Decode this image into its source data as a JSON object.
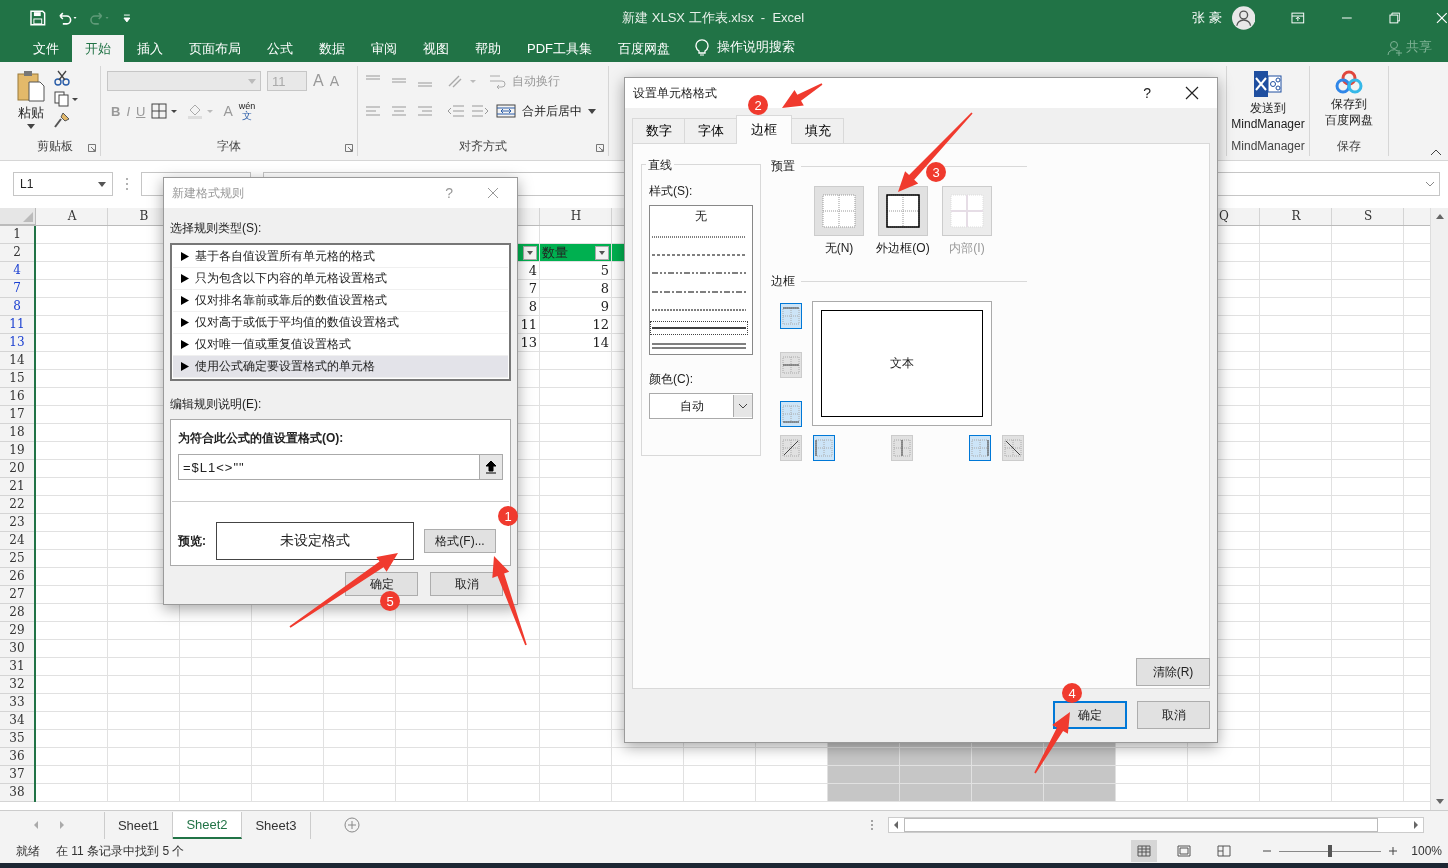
{
  "title_bar": {
    "title": "新建 XLSX 工作表.xlsx  -  Excel",
    "user": "张 豪"
  },
  "ribbon_tabs": [
    {
      "label": "文件",
      "selected": false
    },
    {
      "label": "开始",
      "selected": true
    },
    {
      "label": "插入",
      "selected": false
    },
    {
      "label": "页面布局",
      "selected": false
    },
    {
      "label": "公式",
      "selected": false
    },
    {
      "label": "数据",
      "selected": false
    },
    {
      "label": "审阅",
      "selected": false
    },
    {
      "label": "视图",
      "selected": false
    },
    {
      "label": "帮助",
      "selected": false
    },
    {
      "label": "PDF工具集",
      "selected": false
    },
    {
      "label": "百度网盘",
      "selected": false
    }
  ],
  "tell_me": "操作说明搜索",
  "share": "共享",
  "ribbon": {
    "clipboard": {
      "paste": "粘贴",
      "group_label": "剪贴板"
    },
    "font": {
      "font_size": "11",
      "grow": "A",
      "shrink": "A",
      "bold": "B",
      "italic": "I",
      "underline": "U",
      "font_color": "A",
      "phonetic_top": "wén",
      "phonetic_bottom": "文",
      "group_label": "字体"
    },
    "alignment": {
      "wrap_text": "自动换行",
      "merge_center": "合并后居中",
      "group_label": "对齐方式"
    },
    "mindmanager": {
      "lines": [
        "发送到",
        "MindManager"
      ],
      "group_label": "MindManager"
    },
    "baidu": {
      "lines": [
        "保存到",
        "百度网盘"
      ],
      "group_label": "保存"
    }
  },
  "formula_bar": {
    "name_box": "L1"
  },
  "sheet": {
    "columns": [
      "A",
      "B",
      null,
      null,
      null,
      null,
      null,
      "H",
      null,
      null,
      null,
      null,
      null,
      null,
      null,
      null,
      "Q",
      "R",
      "S"
    ],
    "rows": [
      {
        "label": "1",
        "filtered": false
      },
      {
        "label": "2",
        "filtered": false,
        "kind": "table-header",
        "column_8": "数量"
      },
      {
        "label": "4",
        "filtered": true,
        "column_7": "4",
        "column_8": "5"
      },
      {
        "label": "7",
        "filtered": true,
        "column_7": "7",
        "column_8": "8"
      },
      {
        "label": "8",
        "filtered": true,
        "column_7": "8",
        "column_8": "9"
      },
      {
        "label": "11",
        "filtered": true,
        "column_7": "11",
        "column_8": "12"
      },
      {
        "label": "13",
        "filtered": true,
        "column_7": "13",
        "column_8": "14"
      },
      {
        "label": "14",
        "filtered": false
      },
      {
        "label": "15",
        "filtered": false
      },
      {
        "label": "16",
        "filtered": false
      },
      {
        "label": "17",
        "filtered": false
      },
      {
        "label": "18",
        "filtered": false
      },
      {
        "label": "19",
        "filtered": false
      },
      {
        "label": "20",
        "filtered": false
      },
      {
        "label": "21",
        "filtered": false
      },
      {
        "label": "22",
        "filtered": false
      },
      {
        "label": "23",
        "filtered": false
      },
      {
        "label": "24",
        "filtered": false
      },
      {
        "label": "25",
        "filtered": false
      },
      {
        "label": "26",
        "filtered": false
      },
      {
        "label": "27",
        "filtered": false
      },
      {
        "label": "28",
        "filtered": false
      },
      {
        "label": "29",
        "filtered": false
      },
      {
        "label": "30",
        "filtered": false
      },
      {
        "label": "31",
        "filtered": false
      },
      {
        "label": "32",
        "filtered": false
      },
      {
        "label": "33",
        "filtered": false
      },
      {
        "label": "34",
        "filtered": false
      },
      {
        "label": "35",
        "filtered": false,
        "selected": true
      },
      {
        "label": "36",
        "filtered": false,
        "selected": true
      },
      {
        "label": "37",
        "filtered": false,
        "selected": true
      },
      {
        "label": "38",
        "filtered": false,
        "selected": true
      }
    ]
  },
  "sheet_tabs": [
    {
      "label": "Sheet1",
      "selected": false
    },
    {
      "label": "Sheet2",
      "selected": true
    },
    {
      "label": "Sheet3",
      "selected": false
    }
  ],
  "status_bar": {
    "ready": "就绪",
    "message": "在 11 条记录中找到 5 个",
    "views": [
      {
        "kind": "normal",
        "selected": true
      },
      {
        "kind": "page-layout",
        "selected": false
      },
      {
        "kind": "page-break",
        "selected": false
      }
    ],
    "zoom_slider": {
      "level": 0.5
    },
    "zoom": "100%"
  },
  "rule_dialog": {
    "title": "新建格式规则",
    "help": "?",
    "type_label": "选择规则类型(S):",
    "rule_types": [
      {
        "label": "基于各自值设置所有单元格的格式",
        "selected": false
      },
      {
        "label": "只为包含以下内容的单元格设置格式",
        "selected": false
      },
      {
        "label": "仅对排名靠前或靠后的数值设置格式",
        "selected": false
      },
      {
        "label": "仅对高于或低于平均值的数值设置格式",
        "selected": false
      },
      {
        "label": "仅对唯一值或重复值设置格式",
        "selected": false
      },
      {
        "label": "使用公式确定要设置格式的单元格",
        "selected": true
      }
    ],
    "edit_label": "编辑规则说明(E):",
    "formula_label": "为符合此公式的值设置格式(O):",
    "formula": "=$L1<>\"\"",
    "preview_label": "预览:",
    "preview_text": "未设定格式",
    "format_button": "格式(F)...",
    "ok": "确定",
    "cancel": "取消"
  },
  "format_dialog": {
    "title": "设置单元格格式",
    "help": "?",
    "tabs": [
      {
        "label": "数字",
        "selected": false
      },
      {
        "label": "字体",
        "selected": false
      },
      {
        "label": "边框",
        "selected": true
      },
      {
        "label": "填充",
        "selected": false
      }
    ],
    "line_title": "直线",
    "style_label": "样式(S):",
    "styles": [
      {
        "kind": "none",
        "label": "无",
        "selected": false
      },
      {
        "kind": "dotted",
        "selected": false
      },
      {
        "kind": "dashed",
        "selected": false
      },
      {
        "kind": "dash-dot-dot",
        "selected": false
      },
      {
        "kind": "dash-dot",
        "selected": false
      },
      {
        "kind": "fine-dashed",
        "selected": false
      },
      {
        "kind": "solid",
        "selected": true
      },
      {
        "kind": "double",
        "selected": false
      }
    ],
    "color_label": "颜色(C):",
    "color_value": "自动",
    "preset_title": "预置",
    "presets": [
      {
        "kind": "none",
        "label": "无(N)",
        "disabled": false
      },
      {
        "kind": "outline",
        "label": "外边框(O)",
        "disabled": false
      },
      {
        "kind": "inside",
        "label": "内部(I)",
        "disabled": true
      }
    ],
    "border_title": "边框",
    "preview_text": "文本",
    "side_buttons": [
      {
        "kind": "top",
        "on": true
      },
      {
        "kind": "middle-horizontal",
        "on": false
      },
      {
        "kind": "bottom",
        "on": true
      }
    ],
    "bottom_buttons": [
      {
        "kind": "diagonal-up",
        "on": false
      },
      {
        "kind": "left",
        "on": true
      },
      {
        "kind": "middle-vertical",
        "on": false
      },
      {
        "kind": "right",
        "on": true
      },
      {
        "kind": "diagonal-down",
        "on": false
      }
    ],
    "clear": "清除(R)",
    "ok": "确定",
    "cancel": "取消"
  },
  "annotations": [
    {
      "label": "1"
    },
    {
      "label": "2"
    },
    {
      "label": "3"
    },
    {
      "label": "4"
    },
    {
      "label": "5"
    }
  ]
}
